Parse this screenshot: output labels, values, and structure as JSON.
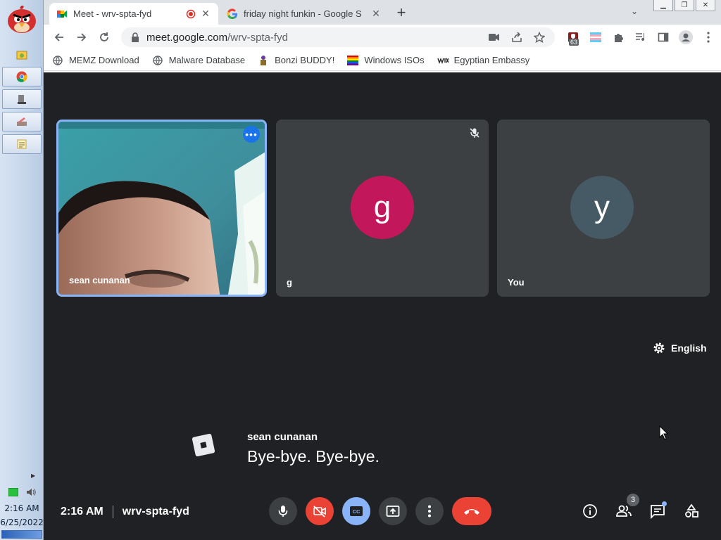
{
  "taskbar": {
    "time": "2:16 AM",
    "date": "6/25/2022"
  },
  "browser": {
    "tabs": [
      {
        "title": "Meet - wrv-spta-fyd",
        "icon": "google-meet-icon",
        "active": true,
        "recording": true
      },
      {
        "title": "friday night funkin - Google S",
        "icon": "google-icon",
        "active": false
      }
    ],
    "new_tab": "+",
    "address": {
      "host": "meet.google.com",
      "path": "/wrv-spta-fyd"
    },
    "extension_badge": "63",
    "bookmarks": [
      {
        "label": "MEMZ Download",
        "icon": "globe-icon"
      },
      {
        "label": "Malware Database",
        "icon": "globe-icon"
      },
      {
        "label": "Bonzi BUDDY!",
        "icon": "bonzi-icon"
      },
      {
        "label": "Windows ISOs",
        "icon": "rainbow-flag-icon"
      },
      {
        "label": "Egyptian Embassy",
        "icon": "wix-icon"
      }
    ]
  },
  "meet": {
    "participants": [
      {
        "name": "sean cunanan",
        "type": "video",
        "pinned_highlight": true
      },
      {
        "name": "g",
        "initial": "g",
        "avatar_color": "#c2185b",
        "muted": true
      },
      {
        "name": "You",
        "initial": "y",
        "avatar_color": "#455a64"
      }
    ],
    "caption_language": "English",
    "caption": {
      "speaker": "sean cunanan",
      "text": "Bye-bye. Bye-bye."
    },
    "meeting_time": "2:16 AM",
    "meeting_code": "wrv-spta-fyd",
    "people_count": "3"
  }
}
